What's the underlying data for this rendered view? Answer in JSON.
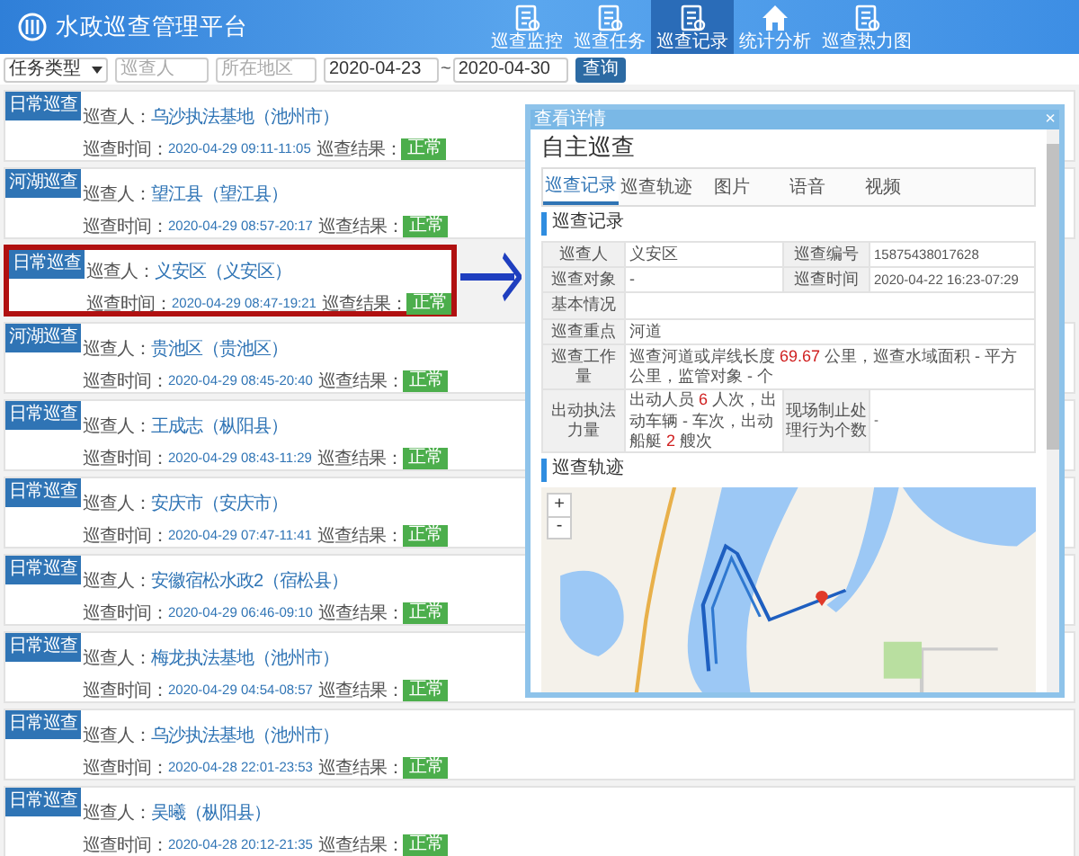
{
  "header": {
    "title": "水政巡查管理平台",
    "nav": [
      {
        "label": "巡查监控",
        "selected": false
      },
      {
        "label": "巡查任务",
        "selected": false
      },
      {
        "label": "巡查记录",
        "selected": true
      },
      {
        "label": "统计分析",
        "selected": false
      },
      {
        "label": "巡查热力图",
        "selected": false
      }
    ]
  },
  "filters": {
    "task_type": "任务类型",
    "inspector_placeholder": "巡查人",
    "region_placeholder": "所在地区",
    "date_from": "2020-04-23",
    "separator": "~",
    "date_to": "2020-04-30",
    "search_button": "查询"
  },
  "records": [
    {
      "type": "日常巡查",
      "inspector_label": "巡查人：",
      "inspector": "乌沙执法基地（池州市）",
      "time_label": "巡查时间：",
      "time": "2020-04-29 09:11-11:05",
      "result_label": "巡查结果：",
      "result": "正常",
      "highlighted": false
    },
    {
      "type": "河湖巡查",
      "inspector_label": "巡查人：",
      "inspector": "望江县（望江县）",
      "time_label": "巡查时间：",
      "time": "2020-04-29 08:57-20:17",
      "result_label": "巡查结果：",
      "result": "正常",
      "highlighted": false
    },
    {
      "type": "日常巡查",
      "inspector_label": "巡查人：",
      "inspector": "义安区（义安区）",
      "time_label": "巡查时间：",
      "time": "2020-04-29 08:47-19:21",
      "result_label": "巡查结果：",
      "result": "正常",
      "highlighted": true
    },
    {
      "type": "河湖巡查",
      "inspector_label": "巡查人：",
      "inspector": "贵池区（贵池区）",
      "time_label": "巡查时间：",
      "time": "2020-04-29 08:45-20:40",
      "result_label": "巡查结果：",
      "result": "正常",
      "highlighted": false
    },
    {
      "type": "日常巡查",
      "inspector_label": "巡查人：",
      "inspector": "王成志（枞阳县）",
      "time_label": "巡查时间：",
      "time": "2020-04-29 08:43-11:29",
      "result_label": "巡查结果：",
      "result": "正常",
      "highlighted": false
    },
    {
      "type": "日常巡查",
      "inspector_label": "巡查人：",
      "inspector": "安庆市（安庆市）",
      "time_label": "巡查时间：",
      "time": "2020-04-29 07:47-11:41",
      "result_label": "巡查结果：",
      "result": "正常",
      "highlighted": false
    },
    {
      "type": "日常巡查",
      "inspector_label": "巡查人：",
      "inspector": "安徽宿松水政2（宿松县）",
      "time_label": "巡查时间：",
      "time": "2020-04-29 06:46-09:10",
      "result_label": "巡查结果：",
      "result": "正常",
      "highlighted": false
    },
    {
      "type": "日常巡查",
      "inspector_label": "巡查人：",
      "inspector": "梅龙执法基地（池州市）",
      "time_label": "巡查时间：",
      "time": "2020-04-29 04:54-08:57",
      "result_label": "巡查结果：",
      "result": "正常",
      "highlighted": false
    },
    {
      "type": "日常巡查",
      "inspector_label": "巡查人：",
      "inspector": "乌沙执法基地（池州市）",
      "time_label": "巡查时间：",
      "time": "2020-04-28 22:01-23:53",
      "result_label": "巡查结果：",
      "result": "正常",
      "highlighted": false
    },
    {
      "type": "日常巡查",
      "inspector_label": "巡查人：",
      "inspector": "吴曦（枞阳县）",
      "time_label": "巡查时间：",
      "time": "2020-04-28 20:12-21:35",
      "result_label": "巡查结果：",
      "result": "正常",
      "highlighted": false
    }
  ],
  "dialog": {
    "window_title": "查看详情",
    "close": "×",
    "heading": "自主巡查",
    "tabs": [
      {
        "label": "巡查记录",
        "selected": true
      },
      {
        "label": "巡查轨迹",
        "selected": false
      },
      {
        "label": "图片",
        "selected": false
      },
      {
        "label": "语音",
        "selected": false
      },
      {
        "label": "视频",
        "selected": false
      }
    ],
    "record_section": "巡查记录",
    "rows": [
      {
        "kind": "pair",
        "label": "巡查人",
        "value": "义安区",
        "label_2": "巡查编号",
        "value_2": "15875438017628"
      },
      {
        "kind": "pair",
        "label": "巡查对象",
        "value": "-",
        "label_2": "巡查时间",
        "value_2": "2020-04-22 16:23-07:29"
      },
      {
        "kind": "single",
        "label": "基本情况"
      },
      {
        "kind": "single",
        "label": "巡查重点",
        "value": "河道"
      },
      {
        "kind": "single",
        "label": "巡查工作量",
        "value": "巡查河道或岸线长度 **69.67** 公里，巡查水域面积 - 平方公里，监管对象 - 个"
      },
      {
        "kind": "pair",
        "label": "出动执法力量",
        "value": "出动人员 **6** 人次，出动车辆 - 车次，出动船艇 **2** 艘次",
        "label_2": "现场制止处理行为个数",
        "value_2": "-"
      }
    ],
    "track_section": "巡查轨迹",
    "zoom_in": "+",
    "zoom_out": "-"
  }
}
